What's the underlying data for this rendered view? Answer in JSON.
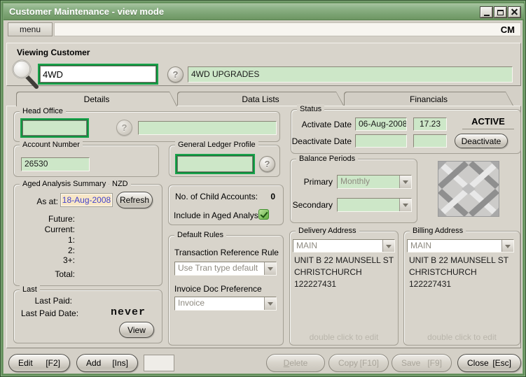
{
  "window": {
    "title": "Customer Maintenance - view mode"
  },
  "menubar": {
    "menu": "menu",
    "module": "CM"
  },
  "viewing_customer": {
    "label": "Viewing Customer",
    "code": "4WD",
    "name": "4WD UPGRADES",
    "help": "?"
  },
  "tabs": {
    "details": "Details",
    "data_lists": "Data Lists",
    "financials": "Financials"
  },
  "head_office": {
    "label": "Head Office",
    "help": "?"
  },
  "account_number": {
    "label": "Account Number",
    "value": "26530"
  },
  "gl_profile": {
    "label": "General Ledger Profile",
    "help": "?"
  },
  "aged_analysis": {
    "label": "Aged Analysis Summary",
    "currency": "NZD",
    "as_at_label": "As at:",
    "as_at_date": "18-Aug-2008",
    "refresh": "Refresh",
    "rows": {
      "future": "Future:",
      "current": "Current:",
      "one": "1:",
      "two": "2:",
      "three_plus": "3+:",
      "total": "Total:"
    }
  },
  "child_accounts": {
    "count_label": "No. of Child Accounts:",
    "count": "0",
    "include_label": "Include in Aged Analysis",
    "include_checked": true
  },
  "default_rules": {
    "label": "Default Rules",
    "tran_ref_label": "Transaction Reference Rule",
    "tran_ref_value": "Use Tran type default",
    "inv_doc_label": "Invoice Doc Preference",
    "inv_doc_value": "Invoice"
  },
  "last": {
    "label": "Last",
    "paid_label": "Last Paid:",
    "paid_date_label": "Last Paid Date:",
    "paid_date_value": "never",
    "view": "View"
  },
  "status": {
    "label": "Status",
    "activate_label": "Activate Date",
    "activate_date": "06-Aug-2008",
    "activate_time": "17.23",
    "deactivate_label": "Deactivate Date",
    "deactivate_date": "",
    "deactivate_time": "",
    "state": "ACTIVE",
    "deactivate_button": "Deactivate"
  },
  "balance_periods": {
    "label": "Balance Periods",
    "primary_label": "Primary",
    "primary_value": "Monthly",
    "secondary_label": "Secondary",
    "secondary_value": ""
  },
  "delivery_address": {
    "label": "Delivery Address",
    "selected": "MAIN",
    "lines": [
      "UNIT B 22 MAUNSELL ST",
      "CHRISTCHURCH",
      "122227431"
    ],
    "hint": "double click to edit"
  },
  "billing_address": {
    "label": "Billing Address",
    "selected": "MAIN",
    "lines": [
      "UNIT B 22 MAUNSELL ST",
      "CHRISTCHURCH",
      "122227431"
    ],
    "hint": "double click to edit"
  },
  "footer": {
    "edit": {
      "text": "Edit",
      "key": "[F2]"
    },
    "add": {
      "text": "Add",
      "key": "[Ins]"
    },
    "delete": {
      "text": "Delete"
    },
    "copy": {
      "text": "Copy",
      "key": "[F10]"
    },
    "save": {
      "text": "Save",
      "key": "[F9]"
    },
    "close": {
      "text": "Close",
      "key": "[Esc]"
    }
  },
  "colors": {
    "titlebar_green": "#85a97d",
    "window_border_green": "#5f8c57",
    "field_green": "#cde7c8",
    "frame_green": "#1aa24b",
    "date_bg": "#f8e7c6",
    "date_text": "#4343cc",
    "disabled_text": "#9b978d"
  }
}
